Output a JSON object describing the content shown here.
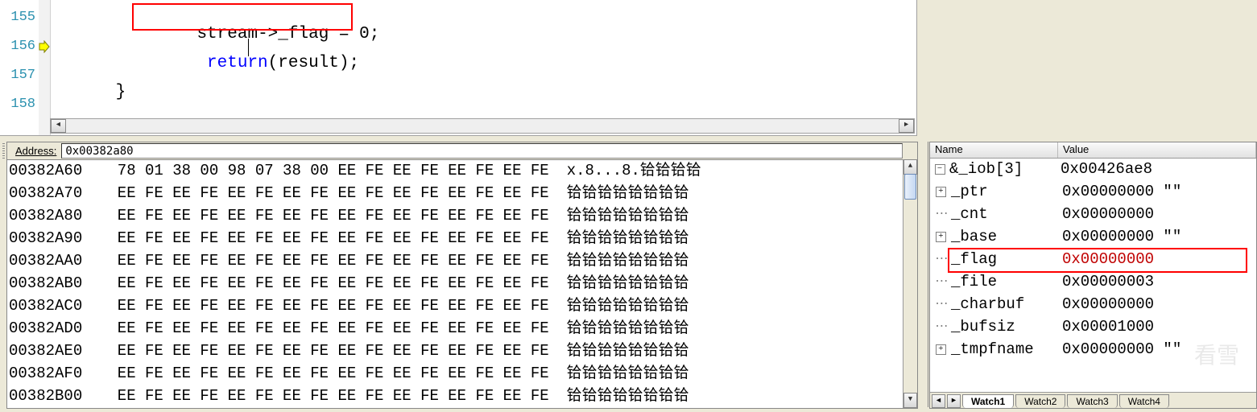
{
  "code": {
    "lines": {
      "155": {
        "num": "155",
        "indent": "        ",
        "t1": "stream",
        "t2": "->_flag = ",
        "t3": "0",
        "t4": ";"
      },
      "156": {
        "num": "156",
        "indent": "         ",
        "kw": "return",
        "t1": "(result);"
      },
      "157": {
        "num": "157",
        "t": "}"
      },
      "158": {
        "num": "158",
        "t": ""
      }
    }
  },
  "memory": {
    "address_label": "Address:",
    "address_value": "0x00382a80",
    "rows": [
      {
        "addr": "00382A60",
        "bytes": "78 01 38 00 98 07 38 00 EE FE EE FE EE FE EE FE",
        "ascii": "x.8...8.铪铪铪铪"
      },
      {
        "addr": "00382A70",
        "bytes": "EE FE EE FE EE FE EE FE EE FE EE FE EE FE EE FE",
        "ascii": "铪铪铪铪铪铪铪铪"
      },
      {
        "addr": "00382A80",
        "bytes": "EE FE EE FE EE FE EE FE EE FE EE FE EE FE EE FE",
        "ascii": "铪铪铪铪铪铪铪铪"
      },
      {
        "addr": "00382A90",
        "bytes": "EE FE EE FE EE FE EE FE EE FE EE FE EE FE EE FE",
        "ascii": "铪铪铪铪铪铪铪铪"
      },
      {
        "addr": "00382AA0",
        "bytes": "EE FE EE FE EE FE EE FE EE FE EE FE EE FE EE FE",
        "ascii": "铪铪铪铪铪铪铪铪"
      },
      {
        "addr": "00382AB0",
        "bytes": "EE FE EE FE EE FE EE FE EE FE EE FE EE FE EE FE",
        "ascii": "铪铪铪铪铪铪铪铪"
      },
      {
        "addr": "00382AC0",
        "bytes": "EE FE EE FE EE FE EE FE EE FE EE FE EE FE EE FE",
        "ascii": "铪铪铪铪铪铪铪铪"
      },
      {
        "addr": "00382AD0",
        "bytes": "EE FE EE FE EE FE EE FE EE FE EE FE EE FE EE FE",
        "ascii": "铪铪铪铪铪铪铪铪"
      },
      {
        "addr": "00382AE0",
        "bytes": "EE FE EE FE EE FE EE FE EE FE EE FE EE FE EE FE",
        "ascii": "铪铪铪铪铪铪铪铪"
      },
      {
        "addr": "00382AF0",
        "bytes": "EE FE EE FE EE FE EE FE EE FE EE FE EE FE EE FE",
        "ascii": "铪铪铪铪铪铪铪铪"
      },
      {
        "addr": "00382B00",
        "bytes": "EE FE EE FE EE FE EE FE EE FE EE FE EE FE EE FE",
        "ascii": "铪铪铪铪铪铪铪铪"
      }
    ]
  },
  "watch": {
    "headers": {
      "name": "Name",
      "value": "Value"
    },
    "rows": [
      {
        "exp": "minus",
        "depth": 0,
        "name": "&_iob[3]",
        "value": "0x00426ae8"
      },
      {
        "exp": "plus",
        "depth": 1,
        "name": "_ptr",
        "value": "0x00000000 \"\""
      },
      {
        "exp": "leaf",
        "depth": 1,
        "name": "_cnt",
        "value": "0x00000000"
      },
      {
        "exp": "plus",
        "depth": 1,
        "name": "_base",
        "value": "0x00000000 \"\""
      },
      {
        "exp": "leaf",
        "depth": 1,
        "name": "_flag",
        "value": "0x00000000",
        "hl": true
      },
      {
        "exp": "leaf",
        "depth": 1,
        "name": "_file",
        "value": "0x00000003"
      },
      {
        "exp": "leaf",
        "depth": 1,
        "name": "_charbuf",
        "value": "0x00000000"
      },
      {
        "exp": "leaf",
        "depth": 1,
        "name": "_bufsiz",
        "value": "0x00001000"
      },
      {
        "exp": "plus",
        "depth": 1,
        "name": "_tmpfname",
        "value": "0x00000000 \"\""
      }
    ],
    "tabs": {
      "w1": "Watch1",
      "w2": "Watch2",
      "w3": "Watch3",
      "w4": "Watch4"
    }
  },
  "glyph": {
    "left": "◄",
    "right": "►",
    "up": "▲",
    "down": "▼"
  },
  "watermark": "看雪"
}
